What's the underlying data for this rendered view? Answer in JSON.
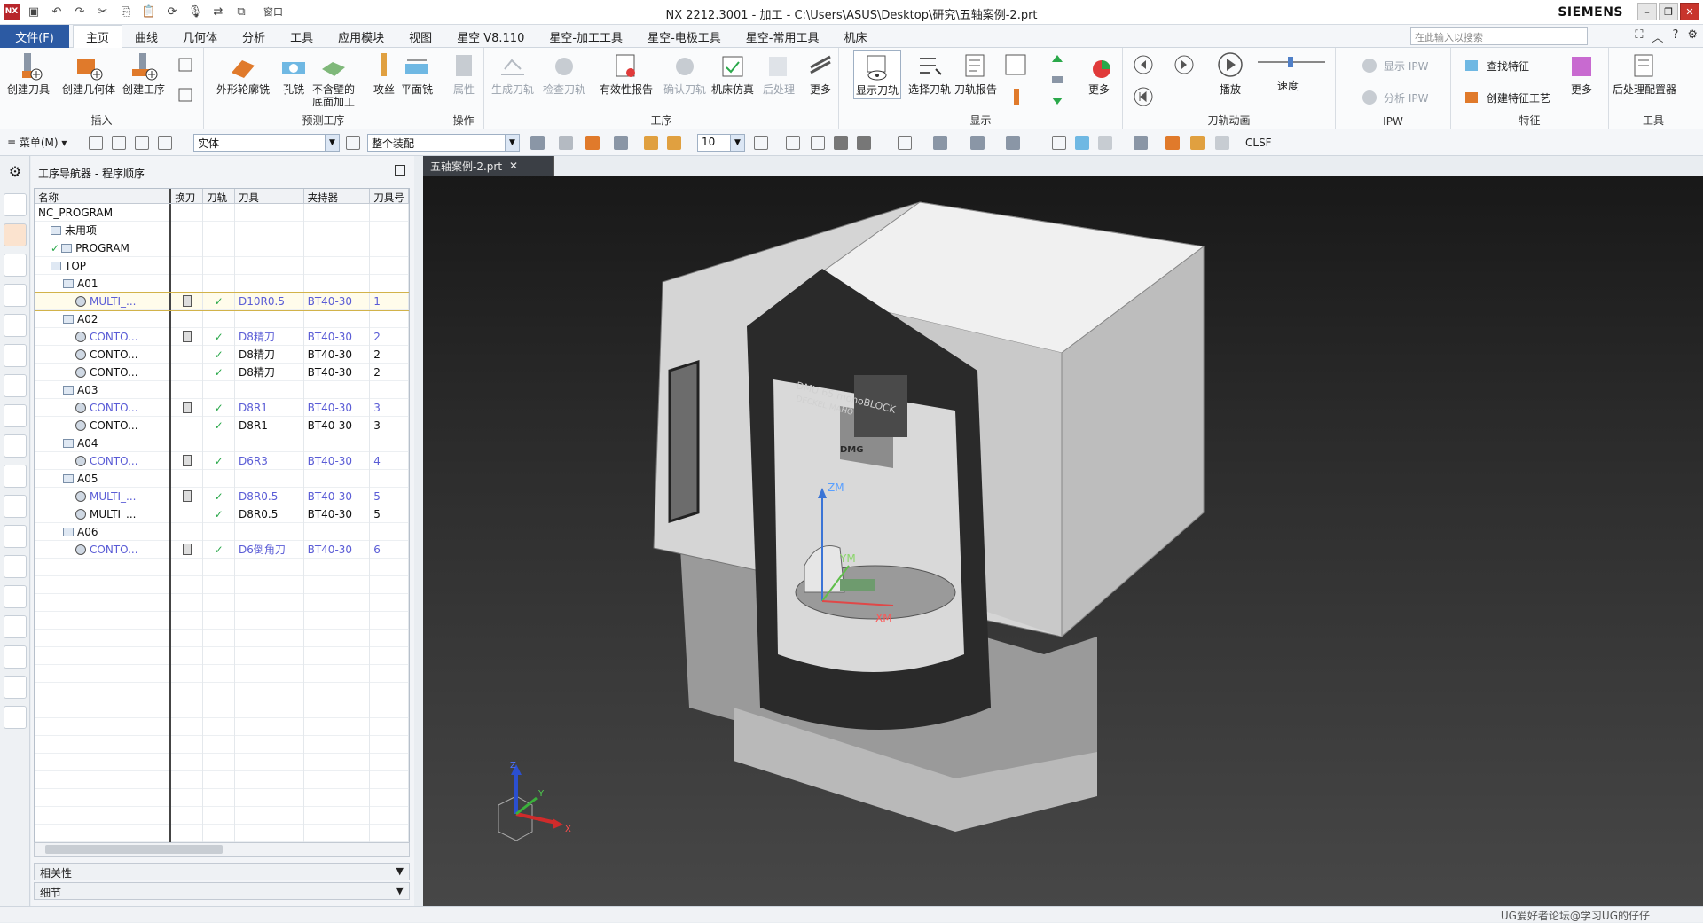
{
  "app": {
    "title": "NX 2212.3001 - 加工 - C:\\Users\\ASUS\\Desktop\\研究\\五轴案例-2.prt",
    "brand": "SIEMENS",
    "window_menu_label": "窗口"
  },
  "menubar": {
    "file_label": "文件(F)",
    "tabs": [
      "主页",
      "曲线",
      "几何体",
      "分析",
      "工具",
      "应用模块",
      "视图",
      "星空 V8.110",
      "星空-加工工具",
      "星空-电极工具",
      "星空-常用工具",
      "机床"
    ],
    "search_placeholder": "在此输入以搜索"
  },
  "ribbon": {
    "insert": {
      "group": "插入",
      "b1": "创建刀具",
      "b2": "创建几何体",
      "b3": "创建工序"
    },
    "predef": {
      "group": "预测工序",
      "b1": "外形轮廓铣",
      "b2": "孔铣",
      "b3a": "不含壁的",
      "b3b": "底面加工",
      "b4": "攻丝",
      "b5": "平面铣"
    },
    "ops": {
      "group": "操作",
      "b1": "属性"
    },
    "process": {
      "group": "工序",
      "b1": "生成刀轨",
      "b2": "检查刀轨",
      "b3": "有效性报告",
      "b4": "确认刀轨",
      "b5": "机床仿真",
      "b6": "后处理",
      "b7": "更多"
    },
    "display": {
      "group": "显示",
      "b1": "显示刀轨",
      "b2": "选择刀轨",
      "b3": "刀轨报告",
      "b4": "更多"
    },
    "anim": {
      "group": "刀轨动画",
      "play": "播放",
      "speed": "速度"
    },
    "ipw": {
      "group": "IPW",
      "b1": "显示 IPW",
      "b2": "分析 IPW"
    },
    "feature": {
      "group": "特征",
      "b1": "查找特征",
      "b2": "创建特征工艺",
      "b3": "更多"
    },
    "tools": {
      "group": "工具",
      "b1": "后处理配置器"
    }
  },
  "toolbar2": {
    "menu_label": "菜单(M)",
    "filter_value": "实体",
    "assembly_value": "整个装配",
    "number_value": "10",
    "clsf_label": "CLSF"
  },
  "navigator": {
    "title": "工序导航器 - 程序顺序",
    "columns": [
      "名称",
      "换刀",
      "刀轨",
      "刀具",
      "夹持器",
      "刀具号"
    ],
    "rows": [
      {
        "indent": 0,
        "name": "NC_PROGRAM",
        "kind": "root"
      },
      {
        "indent": 1,
        "name": "未用项",
        "kind": "folder"
      },
      {
        "indent": 1,
        "name": "PROGRAM",
        "kind": "folder",
        "check": true
      },
      {
        "indent": 1,
        "name": "TOP",
        "kind": "folder"
      },
      {
        "indent": 2,
        "name": "A01",
        "kind": "folder"
      },
      {
        "indent": 3,
        "name": "MULTI_...",
        "kind": "op",
        "blue": true,
        "toolchange": true,
        "path": "✓",
        "tool": "D10R0.5",
        "holder": "BT40-30",
        "num": "1",
        "selected": true
      },
      {
        "indent": 2,
        "name": "A02",
        "kind": "folder"
      },
      {
        "indent": 3,
        "name": "CONTO...",
        "kind": "op",
        "blue": true,
        "toolchange": true,
        "path": "✓",
        "tool": "D8精刀",
        "holder": "BT40-30",
        "num": "2"
      },
      {
        "indent": 3,
        "name": "CONTO...",
        "kind": "op",
        "blue": false,
        "toolchange": false,
        "path": "✓",
        "tool": "D8精刀",
        "holder": "BT40-30",
        "num": "2"
      },
      {
        "indent": 3,
        "name": "CONTO...",
        "kind": "op",
        "blue": false,
        "toolchange": false,
        "path": "✓",
        "tool": "D8精刀",
        "holder": "BT40-30",
        "num": "2"
      },
      {
        "indent": 2,
        "name": "A03",
        "kind": "folder"
      },
      {
        "indent": 3,
        "name": "CONTO...",
        "kind": "op",
        "blue": true,
        "toolchange": true,
        "path": "✓",
        "tool": "D8R1",
        "holder": "BT40-30",
        "num": "3"
      },
      {
        "indent": 3,
        "name": "CONTO...",
        "kind": "op",
        "blue": false,
        "toolchange": false,
        "path": "✓",
        "tool": "D8R1",
        "holder": "BT40-30",
        "num": "3"
      },
      {
        "indent": 2,
        "name": "A04",
        "kind": "folder"
      },
      {
        "indent": 3,
        "name": "CONTO...",
        "kind": "op",
        "blue": true,
        "toolchange": true,
        "path": "✓",
        "tool": "D6R3",
        "holder": "BT40-30",
        "num": "4"
      },
      {
        "indent": 2,
        "name": "A05",
        "kind": "folder"
      },
      {
        "indent": 3,
        "name": "MULTI_...",
        "kind": "op",
        "blue": true,
        "toolchange": true,
        "path": "✓",
        "tool": "D8R0.5",
        "holder": "BT40-30",
        "num": "5"
      },
      {
        "indent": 3,
        "name": "MULTI_...",
        "kind": "op",
        "blue": false,
        "toolchange": false,
        "path": "✓",
        "tool": "D8R0.5",
        "holder": "BT40-30",
        "num": "5"
      },
      {
        "indent": 2,
        "name": "A06",
        "kind": "folder"
      },
      {
        "indent": 3,
        "name": "CONTO...",
        "kind": "op",
        "blue": true,
        "toolchange": true,
        "path": "✓",
        "tool": "D6倒角刀",
        "holder": "BT40-30",
        "num": "6"
      }
    ],
    "bottom_panels": [
      "相关性",
      "细节"
    ]
  },
  "viewport": {
    "tab_label": "五轴案例-2.prt",
    "machine_text_1": "DMU 65 monoBLOCK",
    "machine_text_2": "DECKEL MAHO",
    "machine_logo": "DMG",
    "axis_labels": {
      "zm": "ZM",
      "ym": "YM",
      "xm": "XM",
      "z": "Z",
      "y": "Y",
      "x": "X"
    }
  },
  "status": {
    "watermark": "UG爱好者论坛@学习UG的仔仔"
  },
  "colors": {
    "file_tab": "#2c5aa3",
    "check": "#2aa84a",
    "link": "#5a5cd6",
    "close": "#c8352c"
  }
}
